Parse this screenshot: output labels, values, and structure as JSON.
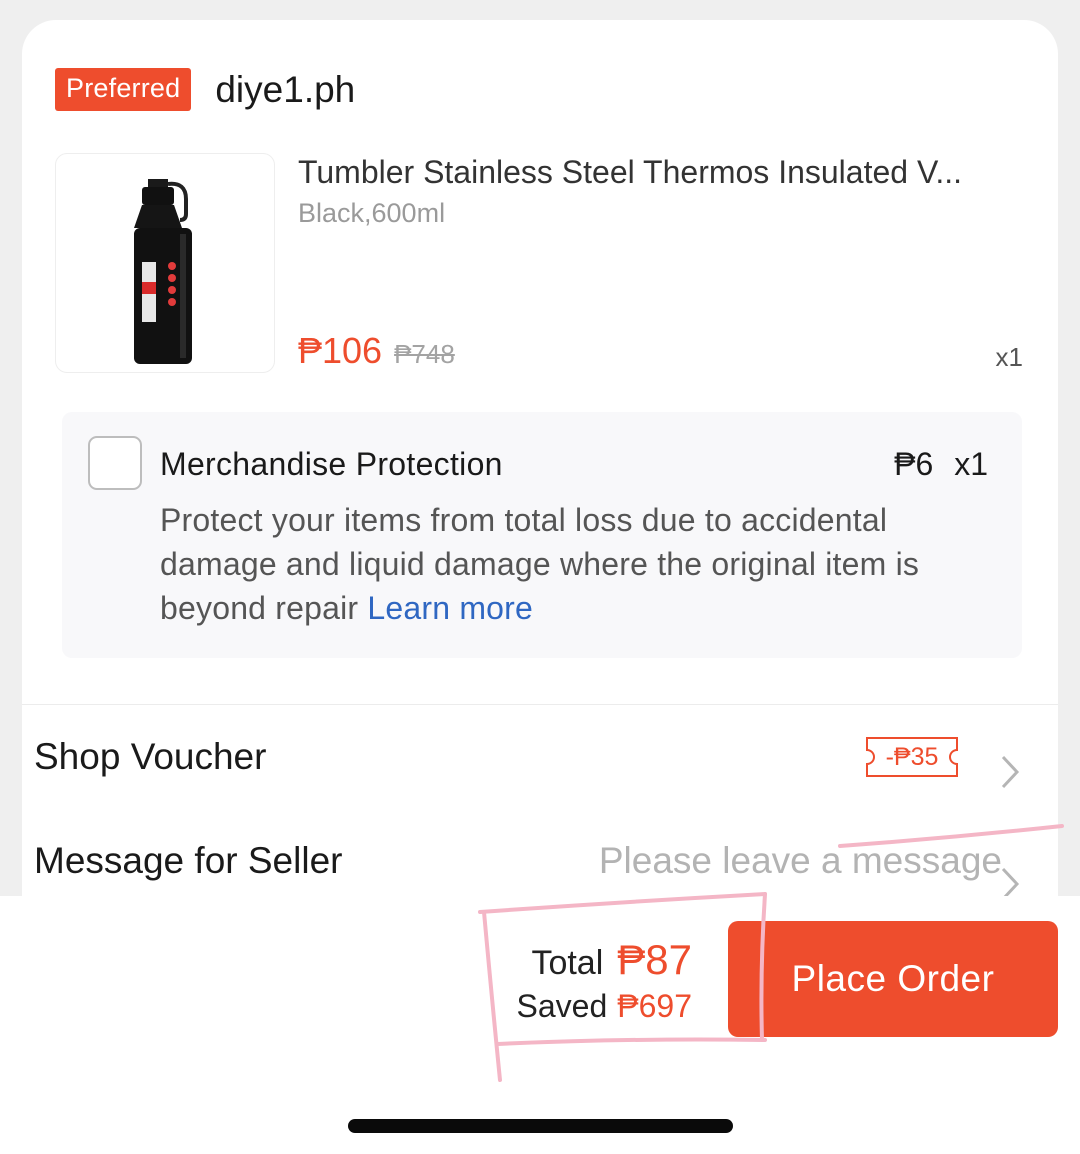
{
  "shop": {
    "badge": "Preferred",
    "name": "diye1.ph"
  },
  "product": {
    "image_icon": "thermos-bottle-image",
    "title": "Tumbler Stainless Steel Thermos Insulated V...",
    "variant": "Black,600ml",
    "price": "₱106",
    "original_price": "₱748",
    "quantity": "x1"
  },
  "protection": {
    "checked": false,
    "title": "Merchandise Protection",
    "price": "₱6",
    "quantity": "x1",
    "description": "Protect your items from total loss due to accidental damage and liquid damage where the original item is beyond repair",
    "learn_more": "Learn more"
  },
  "voucher": {
    "label": "Shop Voucher",
    "value": "-₱35"
  },
  "message": {
    "label": "Message for Seller",
    "placeholder": "Please leave a message"
  },
  "footer": {
    "total_label": "Total",
    "total_amount": "₱87",
    "saved_label": "Saved",
    "saved_amount": "₱697",
    "place_order_label": "Place Order"
  },
  "colors": {
    "accent": "#ee4d2d",
    "link": "#2f67c2",
    "annotation": "#f4b6c6"
  }
}
